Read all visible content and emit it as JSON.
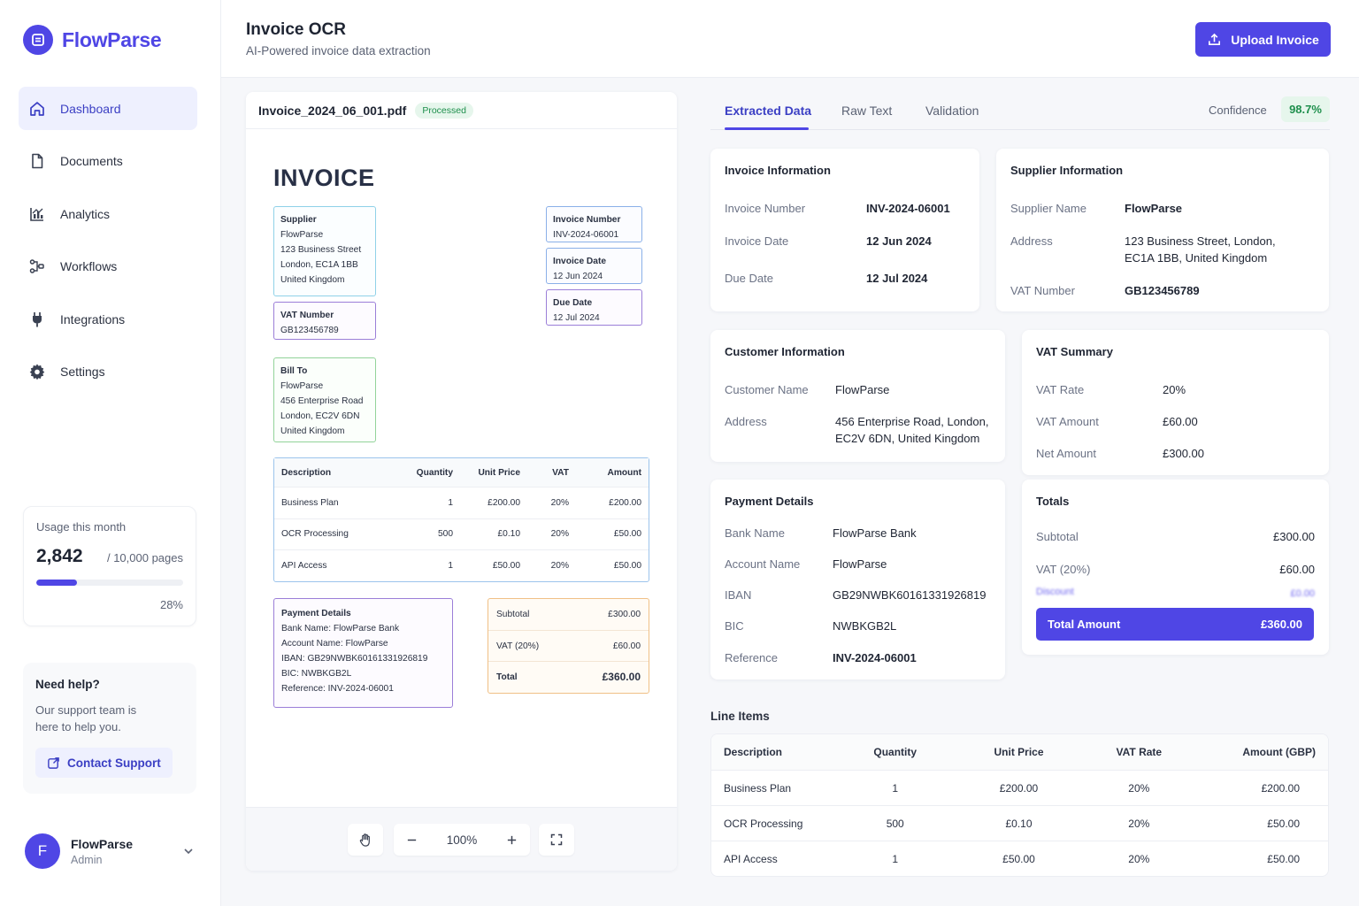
{
  "brand": {
    "name": "FlowParse",
    "accent": "#4f46e5"
  },
  "sidebar": {
    "items": [
      {
        "label": "Dashboard",
        "icon": "home-icon",
        "active": true
      },
      {
        "label": "Documents",
        "icon": "document-icon"
      },
      {
        "label": "Analytics",
        "icon": "analytics-icon"
      },
      {
        "label": "Workflows",
        "icon": "workflow-icon"
      },
      {
        "label": "Integrations",
        "icon": "plug-icon"
      },
      {
        "label": "Settings",
        "icon": "gear-icon"
      }
    ],
    "usage": {
      "label": "Usage this month",
      "value": "2,842",
      "total": "/ 10,000 pages",
      "percent": "28%",
      "fraction": 0.28
    },
    "help": {
      "title": "Need help?",
      "text": "Our support team is here to help you.",
      "button": "Contact Support"
    },
    "user": {
      "initial": "F",
      "name": "FlowParse",
      "role": "Admin"
    }
  },
  "header": {
    "title": "Invoice OCR",
    "subtitle": "AI-Powered invoice data extraction",
    "upload_label": "Upload Invoice"
  },
  "preview": {
    "file_name": "Invoice_2024_06_001.pdf",
    "status": "Processed",
    "zoom": "100%",
    "doc": {
      "title": "INVOICE",
      "supplier": {
        "title": "Supplier",
        "lines": [
          "FlowParse",
          "123 Business Street",
          "London, EC1A 1BB",
          "United Kingdom"
        ]
      },
      "vat": {
        "title": "VAT Number",
        "value": "GB123456789"
      },
      "bill_to": {
        "title": "Bill To",
        "lines": [
          "FlowParse",
          "456 Enterprise Road",
          "London, EC2V 6DN",
          "United Kingdom"
        ]
      },
      "invoice_number": {
        "title": "Invoice Number",
        "value": "INV-2024-06001"
      },
      "invoice_date": {
        "title": "Invoice Date",
        "value": "12 Jun 2024"
      },
      "due_date": {
        "title": "Due Date",
        "value": "12 Jul 2024"
      },
      "table": {
        "headers": [
          "Description",
          "Quantity",
          "Unit Price",
          "VAT",
          "Amount"
        ],
        "rows": [
          [
            "Business Plan",
            "1",
            "£200.00",
            "20%",
            "£200.00"
          ],
          [
            "OCR Processing",
            "500",
            "£0.10",
            "20%",
            "£50.00"
          ],
          [
            "API Access",
            "1",
            "£50.00",
            "20%",
            "£50.00"
          ]
        ]
      },
      "payment": {
        "title": "Payment Details",
        "lines": [
          "Bank Name: FlowParse Bank",
          "Account Name: FlowParse",
          "IBAN: GB29NWBK60161331926819",
          "BIC: NWBKGB2L",
          "Reference: INV-2024-06001"
        ]
      },
      "summary": [
        {
          "label": "Subtotal",
          "value": "£300.00"
        },
        {
          "label": "VAT (20%)",
          "value": "£60.00"
        },
        {
          "label": "Total",
          "value": "£360.00"
        }
      ]
    }
  },
  "tabs": {
    "items": [
      "Extracted Data",
      "Raw Text",
      "Validation"
    ],
    "confidence_label": "Confidence",
    "confidence_value": "98.7%"
  },
  "invoice_info": {
    "title": "Invoice Information",
    "rows": [
      {
        "k": "Invoice Number",
        "v": "INV-2024-06001"
      },
      {
        "k": "Invoice Date",
        "v": "12 Jun 2024"
      },
      {
        "k": "Due Date",
        "v": "12 Jul 2024"
      }
    ]
  },
  "supplier_info": {
    "title": "Supplier Information",
    "rows": [
      {
        "k": "Supplier Name",
        "v": "FlowParse"
      },
      {
        "k": "Address",
        "v": "123 Business Street, London, EC1A 1BB, United Kingdom"
      },
      {
        "k": "VAT Number",
        "v": "GB123456789"
      }
    ]
  },
  "customer_info": {
    "title": "Customer Information",
    "rows": [
      {
        "k": "Customer Name",
        "v": "FlowParse"
      },
      {
        "k": "Address",
        "v": "456 Enterprise Road, London, EC2V 6DN, United Kingdom"
      }
    ]
  },
  "vat_summary": {
    "title": "VAT Summary",
    "rows": [
      {
        "k": "VAT Rate",
        "v": "20%"
      },
      {
        "k": "VAT Amount",
        "v": "£60.00"
      },
      {
        "k": "Net Amount",
        "v": "£300.00"
      }
    ]
  },
  "payment_details": {
    "title": "Payment Details",
    "rows": [
      {
        "k": "Bank Name",
        "v": "FlowParse Bank"
      },
      {
        "k": "Account Name",
        "v": "FlowParse"
      },
      {
        "k": "IBAN",
        "v": "GB29NWBK60161331926819"
      },
      {
        "k": "BIC",
        "v": "NWBKGB2L"
      },
      {
        "k": "Reference",
        "v": "INV-2024-06001"
      }
    ]
  },
  "totals": {
    "title": "Totals",
    "rows": [
      {
        "k": "Subtotal",
        "v": "£300.00"
      },
      {
        "k": "VAT (20%)",
        "v": "£60.00"
      },
      {
        "k": "Discount",
        "v": "£0.00"
      }
    ],
    "total_label": "Total Amount",
    "total_value": "£360.00"
  },
  "line_items": {
    "title": "Line Items",
    "headers": [
      "Description",
      "Quantity",
      "Unit Price",
      "VAT Rate",
      "Amount (GBP)"
    ],
    "rows": [
      [
        "Business Plan",
        "1",
        "£200.00",
        "20%",
        "£200.00"
      ],
      [
        "OCR Processing",
        "500",
        "£0.10",
        "20%",
        "£50.00"
      ],
      [
        "API Access",
        "1",
        "£50.00",
        "20%",
        "£50.00"
      ]
    ]
  }
}
